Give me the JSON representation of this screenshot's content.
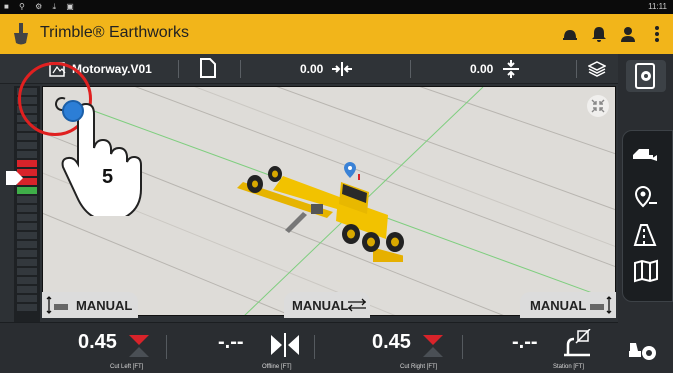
{
  "status_bar": {
    "time": "11:11",
    "left_icons": [
      "square-icon",
      "usb-icon",
      "gear-icon",
      "download-icon",
      "image-icon"
    ]
  },
  "app": {
    "title": "Trimble® Earthworks"
  },
  "toolbar": {
    "design_name": "Motorway.V01",
    "offset_horizontal": "0.00",
    "offset_vertical": "0.00"
  },
  "view": {
    "step_number": "5",
    "modes": {
      "left": "MANUAL",
      "center": "MANUAL",
      "right": "MANUAL"
    }
  },
  "bottom": {
    "cut_left_value": "0.45",
    "cut_left_label": "Cut Left  [FT]",
    "offline_value": "-.--",
    "offline_label": "Offline  [FT]",
    "cut_right_value": "0.45",
    "cut_right_label": "Cut Right  [FT]",
    "station_value": "-.--",
    "station_label": "Station  [FT]"
  },
  "colors": {
    "accent": "#f2b51a",
    "cut_red": "#d8232a",
    "indicator_green": "#3fae49"
  }
}
